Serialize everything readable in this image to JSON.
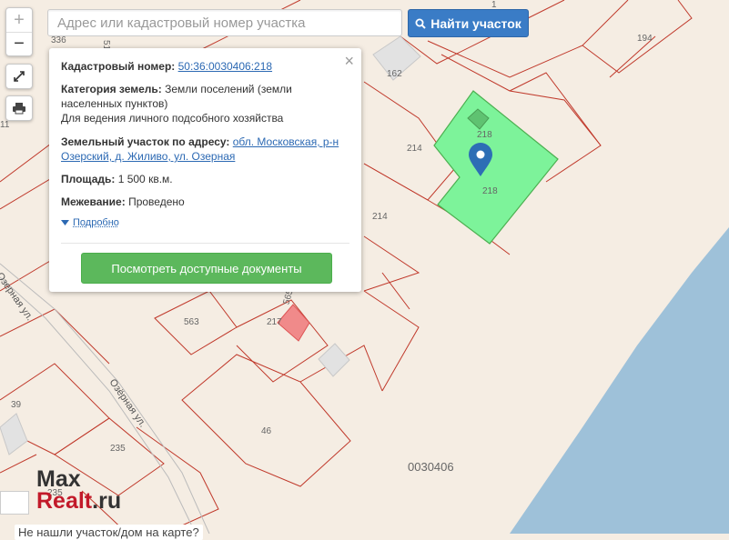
{
  "map": {
    "water_color": "#9ec1d9",
    "land_color": "#f5ede3",
    "parcel_line_color": "#c0392b",
    "selected_fill": "#7df39a",
    "selected_stroke": "#4caf50",
    "building_fill": "#e2e2e2",
    "labels": {
      "p336": "336",
      "p162": "162",
      "p194": "194",
      "p214a": "214",
      "p218a": "218",
      "p218b": "218",
      "p214b": "214",
      "p563": "563",
      "p217": "217",
      "p565": "565",
      "p39": "39",
      "p235": "235",
      "p46": "46",
      "p235b": "235",
      "p11": "11",
      "p51": "51",
      "p1": "1",
      "block": "0030406",
      "street1": "Озерная ул.",
      "street2": "Озёрная ул."
    }
  },
  "controls": {
    "zoom_in": "+",
    "zoom_out": "−",
    "fullscreen_icon": "expand-icon",
    "print_icon": "printer-icon"
  },
  "search": {
    "placeholder": "Адрес или кадастровый номер участка",
    "button_label": "Найти участок"
  },
  "popup": {
    "cadastral_label": "Кадастровый номер:",
    "cadastral_value": "50:36:0030406:218",
    "category_label": "Категория земель:",
    "category_value": "Земли поселений (земли населенных пунктов)",
    "usage": "Для ведения личного подсобного хозяйства",
    "address_label": "Земельный участок по адресу:",
    "address_value": "обл. Московская, р-н Озерский, д. Жиливо, ул. Озерная",
    "area_label": "Площадь:",
    "area_value": "1 500 кв.м.",
    "survey_label": "Межевание:",
    "survey_value": "Проведено",
    "more_label": "Подробно",
    "docs_button": "Посмотреть доступные документы",
    "close": "×"
  },
  "branding": {
    "line1": "Max",
    "line2_a": "Realt",
    "line2_b": ".ru"
  },
  "footer": {
    "link_text": "Не нашли участок/дом на карте?"
  }
}
